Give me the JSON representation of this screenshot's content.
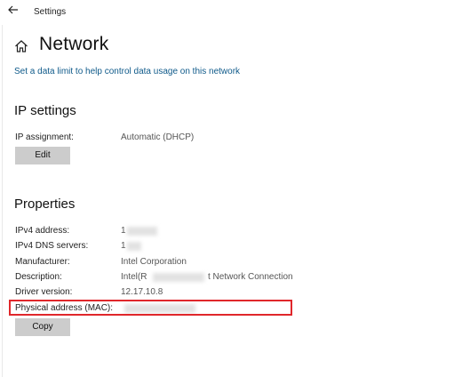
{
  "window": {
    "title": "Settings"
  },
  "header": {
    "title": "Network"
  },
  "link": {
    "data_limit": "Set a data limit to help control data usage on this network"
  },
  "ip_settings": {
    "heading": "IP settings",
    "assignment_label": "IP assignment:",
    "assignment_value": "Automatic (DHCP)",
    "edit_label": "Edit"
  },
  "properties": {
    "heading": "Properties",
    "ipv4_label": "IPv4 address:",
    "ipv4_value": "1",
    "dns_label": "IPv4 DNS servers:",
    "dns_value": "1",
    "manufacturer_label": "Manufacturer:",
    "manufacturer_value": "Intel Corporation",
    "description_label": "Description:",
    "description_value_start": "Intel(R",
    "description_value_end": "t Network Connection",
    "driver_label": "Driver version:",
    "driver_value": "12.17.10.8",
    "mac_label": "Physical address (MAC):",
    "copy_label": "Copy"
  },
  "colors": {
    "link": "#0f5a8a",
    "button_bg": "#cccccc",
    "highlight_border": "#e0272b"
  },
  "icons": {
    "back": "back-arrow-icon",
    "home": "home-icon"
  }
}
